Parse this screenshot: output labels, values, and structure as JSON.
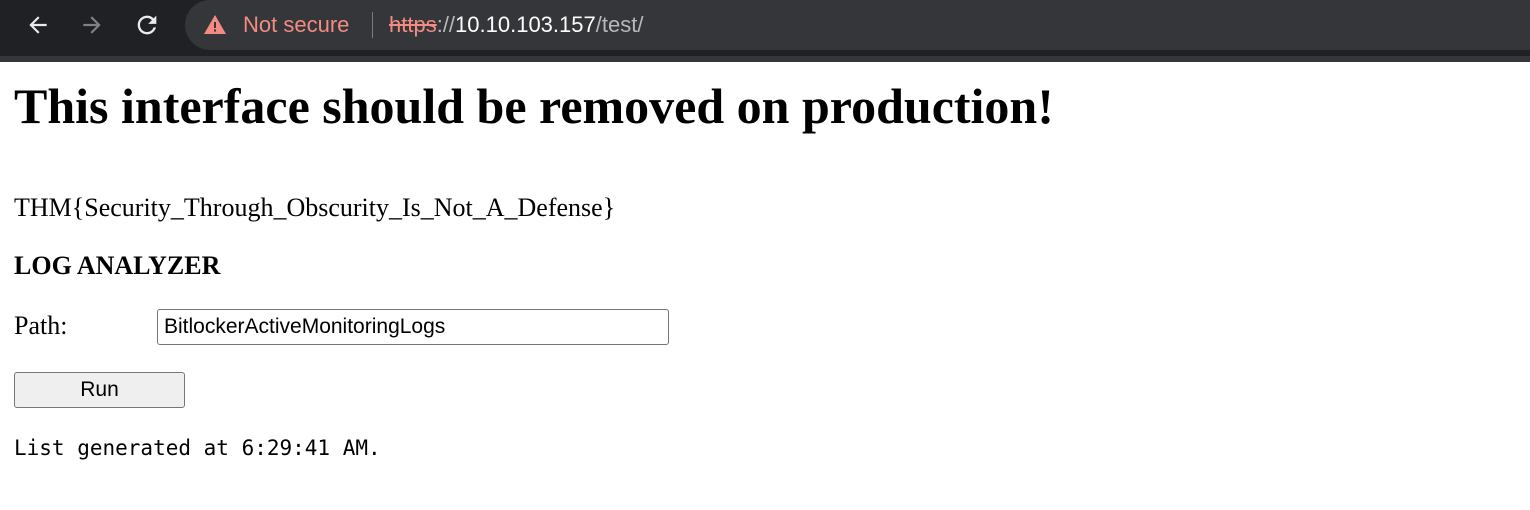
{
  "browser": {
    "security_label": "Not secure",
    "url": {
      "scheme": "https",
      "separator": "://",
      "host": "10.10.103.157",
      "path": "/test/"
    },
    "icons": {
      "back": "arrow-left-icon",
      "forward": "arrow-right-icon",
      "reload": "reload-icon",
      "warning": "warning-triangle-icon"
    },
    "colors": {
      "toolbar": "#202124",
      "omnibox": "#35363a",
      "warning": "#f28b82"
    }
  },
  "page": {
    "heading": "This interface should be removed on production!",
    "flag": "THM{Security_Through_Obscurity_Is_Not_A_Defense}",
    "section_title": "LOG ANALYZER",
    "form": {
      "path_label": "Path:",
      "path_value": "BitlockerActiveMonitoringLogs",
      "run_label": "Run"
    },
    "status": "List generated at 6:29:41 AM."
  }
}
